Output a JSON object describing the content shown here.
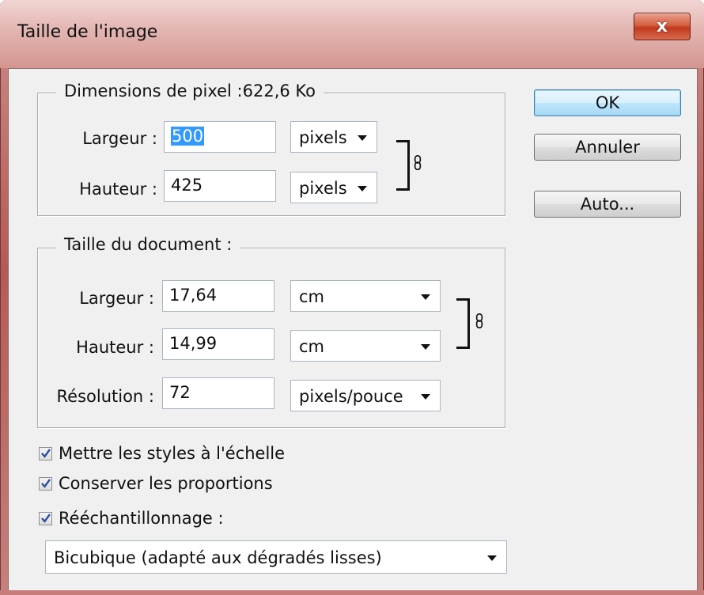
{
  "window": {
    "title": "Taille de l'image",
    "close_glyph": "x"
  },
  "pixel_dims": {
    "legend": "Dimensions de pixel :622,6 Ko",
    "width_label": "Largeur :",
    "width_value": "500",
    "width_unit": "pixels",
    "height_label": "Hauteur :",
    "height_value": "425",
    "height_unit": "pixels"
  },
  "document": {
    "legend": "Taille du document :",
    "width_label": "Largeur :",
    "width_value": "17,64",
    "width_unit": "cm",
    "height_label": "Hauteur :",
    "height_value": "14,99",
    "height_unit": "cm",
    "res_label": "Résolution :",
    "res_value": "72",
    "res_unit": "pixels/pouce"
  },
  "buttons": {
    "ok": "OK",
    "cancel": "Annuler",
    "auto": "Auto..."
  },
  "options": {
    "scale_styles": {
      "label": "Mettre les styles à l'échelle",
      "checked": true
    },
    "constrain": {
      "label": "Conserver les proportions",
      "checked": true
    },
    "resample": {
      "label": "Rééchantillonnage :",
      "checked": true
    }
  },
  "resample_method": "Bicubique (adapté aux dégradés lisses)",
  "icons": {
    "link": "chain-link-icon",
    "check": "checkmark-icon",
    "dropdown": "chevron-down-icon"
  }
}
